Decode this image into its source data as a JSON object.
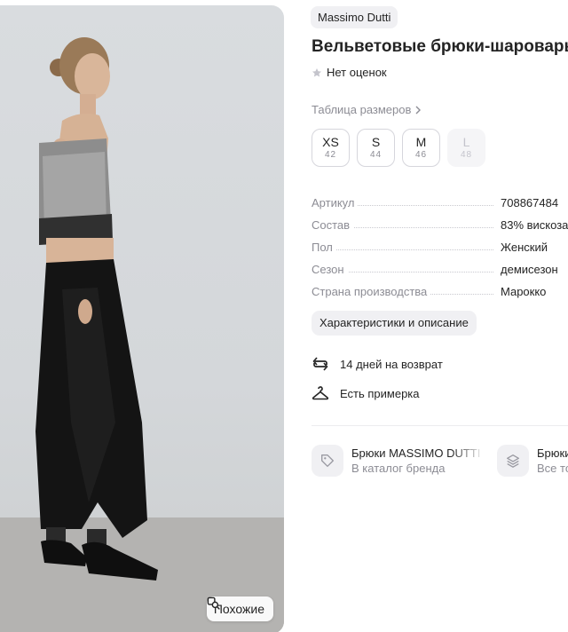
{
  "brand": "Massimo Dutti",
  "title": "Вельветовые брюки-шаровары",
  "rating": {
    "text": "Нет оценок",
    "icon": "star-icon"
  },
  "sizes_link": "Таблица размеров",
  "sizes": [
    {
      "label": "XS",
      "ru": "42",
      "available": true
    },
    {
      "label": "S",
      "ru": "44",
      "available": true
    },
    {
      "label": "M",
      "ru": "46",
      "available": true
    },
    {
      "label": "L",
      "ru": "48",
      "available": false
    }
  ],
  "specs": [
    {
      "key": "Артикул",
      "value": "708867484"
    },
    {
      "key": "Состав",
      "value": "83% вискоза"
    },
    {
      "key": "Пол",
      "value": "Женский"
    },
    {
      "key": "Сезон",
      "value": "демисезон"
    },
    {
      "key": "Страна производства",
      "value": "Марокко"
    }
  ],
  "chars_button": "Характеристики и описание",
  "perks": [
    {
      "icon": "return-arrows-icon",
      "text": "14 дней на возврат"
    },
    {
      "icon": "hanger-icon",
      "text": "Есть примерка"
    }
  ],
  "cards": [
    {
      "icon": "tag-icon",
      "title": "Брюки MASSIMO DUTTI",
      "subtitle": "В каталог бренда"
    },
    {
      "icon": "stack-icon",
      "title": "Брюки",
      "subtitle": "Все то"
    }
  ],
  "photo": {
    "similar_label": "Похожие"
  },
  "colors": {
    "chip_bg": "#f0f0f3",
    "text": "#242424",
    "muted": "#8c8c94"
  }
}
